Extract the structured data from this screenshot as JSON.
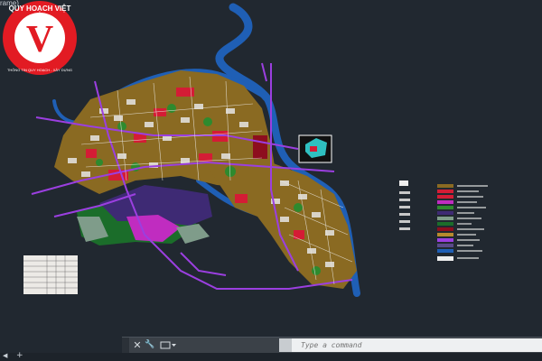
{
  "window": {
    "tab_label": "rame)"
  },
  "logo": {
    "brand_top": "QUY HOẠCH VIỆT",
    "brand_bottom": "THÔNG TIN QUY HOẠCH - XÂY DỰNG",
    "letter": "V"
  },
  "command": {
    "placeholder": "Type a command",
    "close_glyph": "✕",
    "wrench_glyph": "🔧"
  },
  "statusbar": {
    "first_tab_glyph": "◀",
    "add_glyph": "+"
  },
  "colors": {
    "background": "#212830",
    "river": "#1f5fb5",
    "road": "#9b3fe0",
    "logo_red": "#e21b23"
  }
}
